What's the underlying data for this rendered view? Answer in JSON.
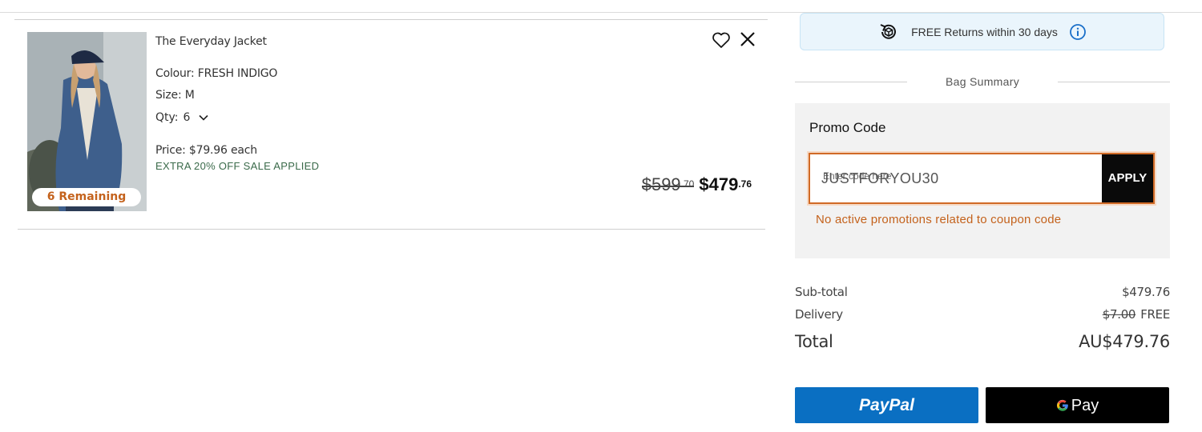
{
  "cart_item": {
    "name": "The Everyday Jacket",
    "colour": "Colour: FRESH INDIGO",
    "size": "Size: M",
    "qty_label": "Qty:",
    "qty_value": "6",
    "price_each": "Price: $79.96 each",
    "sale_note": "EXTRA 20% OFF SALE APPLIED",
    "remaining_badge": "6 Remaining",
    "old_price_main": "$599",
    "old_price_cents": ".70",
    "new_price_main": "$479",
    "new_price_cents": ".76"
  },
  "returns_banner": {
    "text": "FREE Returns within 30 days"
  },
  "summary": {
    "heading": "Bag Summary",
    "promo": {
      "title": "Promo Code",
      "floating_label": "Enter code here",
      "value": "JUSTFORYOU30",
      "apply_label": "APPLY",
      "error": "No active promotions related to coupon code"
    },
    "subtotal_label": "Sub-total",
    "subtotal_value": "$479.76",
    "delivery_label": "Delivery",
    "delivery_old": "$7.00",
    "delivery_value": "FREE",
    "total_label": "Total",
    "total_value": "AU$479.76"
  },
  "payment": {
    "paypal_label": "PayPal",
    "gpay_label": "Pay"
  },
  "colors": {
    "accent_orange": "#c4621c",
    "sale_green": "#3a6a4a",
    "paypal_blue": "#0a6fc2",
    "banner_bg": "#eaf5fc",
    "info_blue": "#1a6fc9"
  },
  "icons": {
    "wishlist": "heart-icon",
    "remove": "close-icon",
    "qty": "chevron-down-icon",
    "returns": "returns-cycle-icon",
    "info": "info-icon",
    "google": "google-g-icon"
  }
}
